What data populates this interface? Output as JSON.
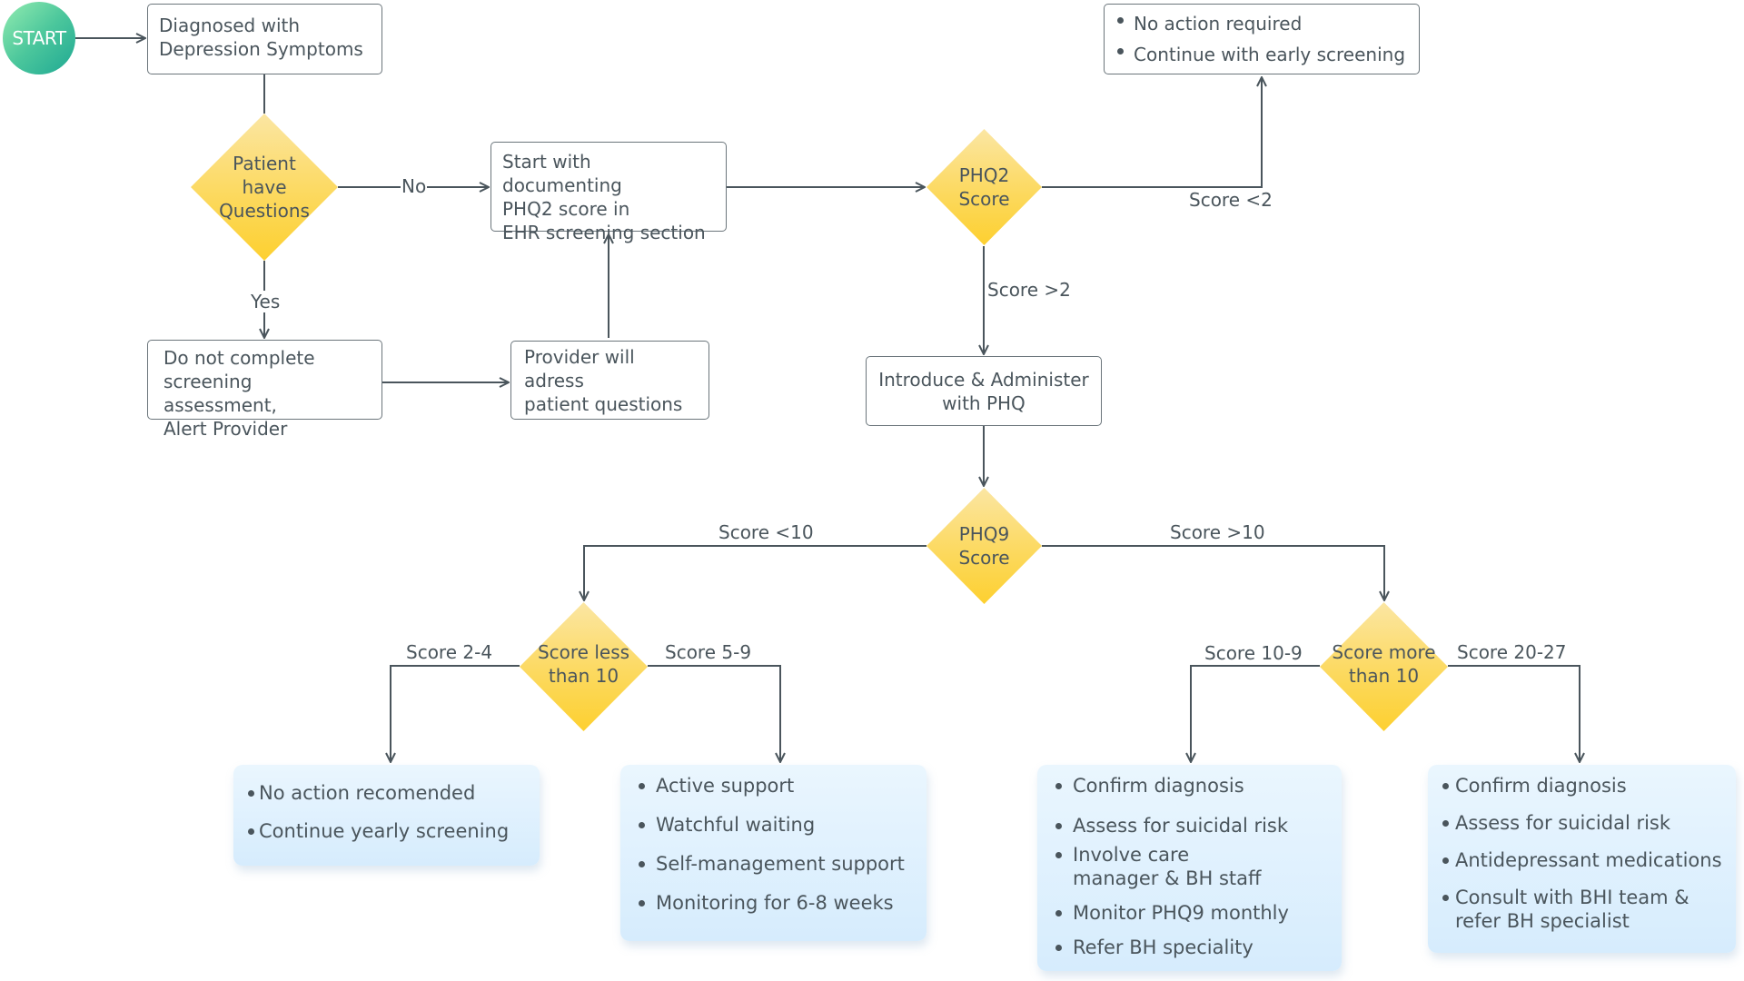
{
  "start": {
    "label": "START"
  },
  "nodes": {
    "diagnosed": [
      "Diagnosed with",
      "Depression Symptoms"
    ],
    "patient_questions": [
      "Patient",
      "have",
      "Questions"
    ],
    "documenting": [
      "Start with documenting",
      "PHQ2 score in",
      "EHR screening section"
    ],
    "do_not_complete": [
      "Do not complete",
      "screening assessment,",
      "Alert Provider"
    ],
    "provider_address": [
      "Provider will adress",
      "patient questions"
    ],
    "phq2": [
      "PHQ2",
      "Score"
    ],
    "no_action_required": [
      "No action required",
      "Continue with early screening"
    ],
    "introduce": [
      "Introduce & Administer",
      "with PHQ"
    ],
    "phq9": [
      "PHQ9",
      "Score"
    ],
    "score_less_10": [
      "Score less",
      "than 10"
    ],
    "score_more_10": [
      "Score more",
      "than 10"
    ]
  },
  "edge_labels": {
    "no": "No",
    "yes": "Yes",
    "score_lt_2": "Score <2",
    "score_gt_2": "Score >2",
    "score_lt_10": "Score <10",
    "score_gt_10": "Score >10",
    "score_2_4": "Score 2-4",
    "score_5_9": "Score 5-9",
    "score_10_9": "Score 10-9",
    "score_20_27": "Score 20-27"
  },
  "outcomes": {
    "score_2_4": [
      "No action recomended",
      "Continue yearly screening"
    ],
    "score_5_9": [
      "Active support",
      "Watchful waiting",
      "Self-management support",
      "Monitoring for 6-8 weeks"
    ],
    "score_10_19": [
      "Confirm diagnosis",
      "Assess for suicidal risk",
      "Involve care manager & BH staff",
      "Monitor PHQ9 monthly",
      "Refer BH speciality"
    ],
    "score_20_27": [
      "Confirm diagnosis",
      "Assess for suicidal risk",
      "Antidepressant medications",
      "Consult with BHI team & refer BH specialist"
    ]
  },
  "colors": {
    "line": "#4a555c",
    "start_gradient": [
      "#93ecb0",
      "#1ea893"
    ],
    "decision_gradient": [
      "#fbe6a3",
      "#fdd030"
    ],
    "outcome_card": [
      "#eaf6fe",
      "#d6ecfd"
    ]
  }
}
